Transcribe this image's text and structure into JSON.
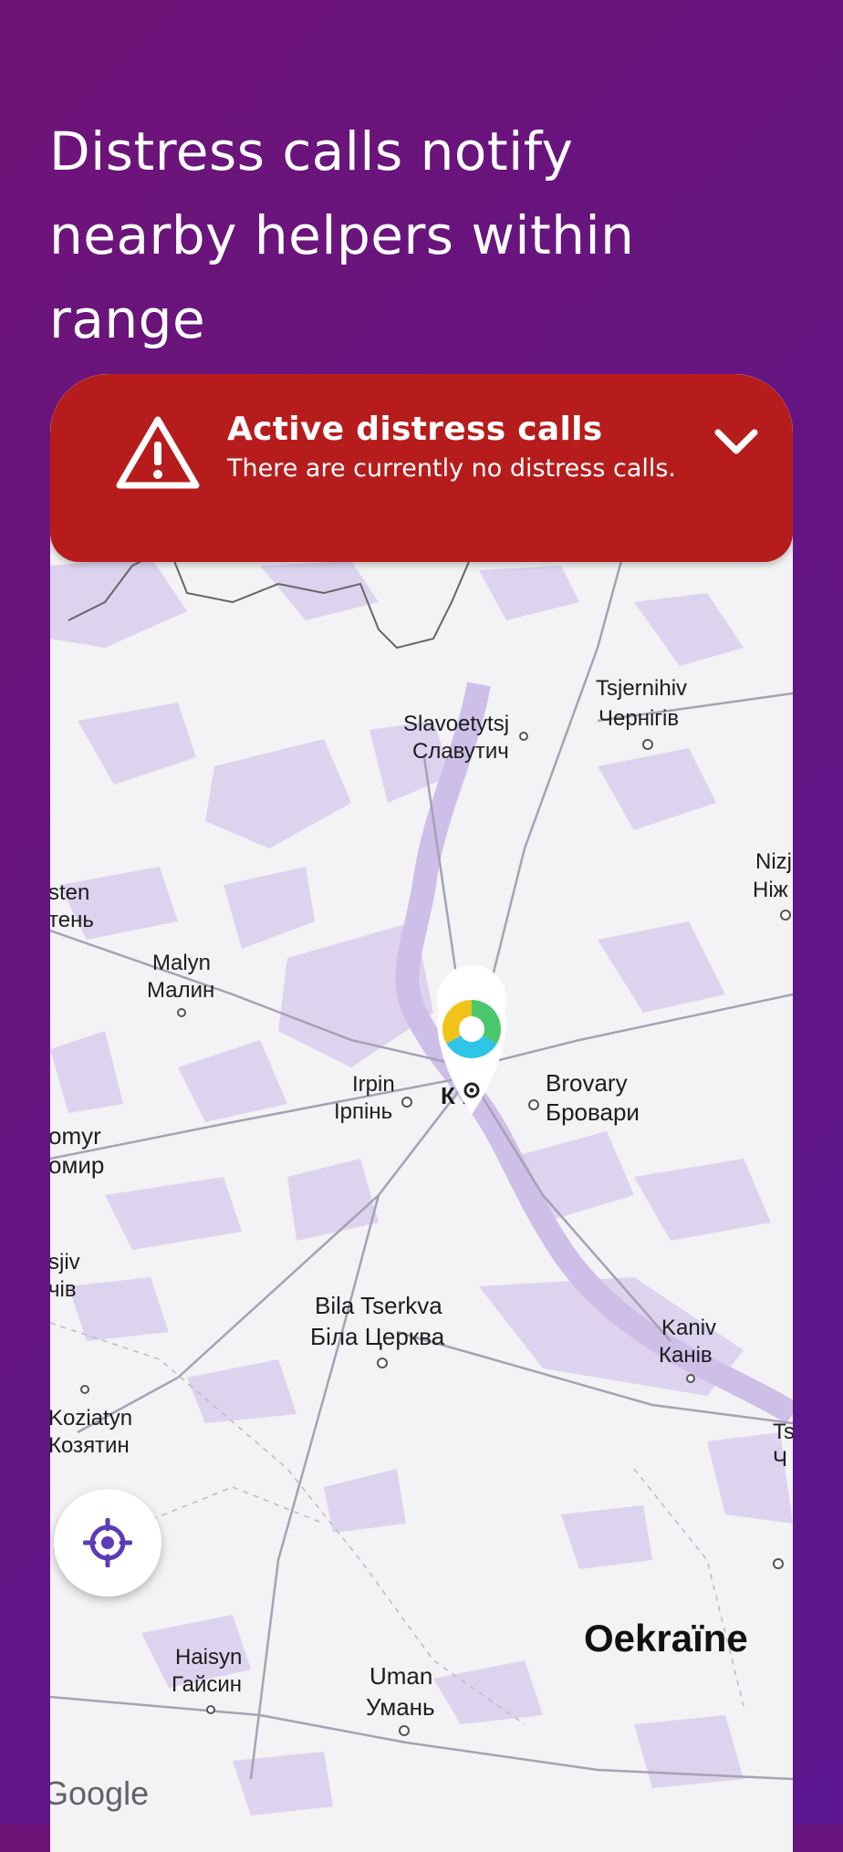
{
  "headline": [
    "Distress calls notify",
    "nearby helpers within",
    "range"
  ],
  "banner": {
    "title": "Active distress calls",
    "subtitle": "There are currently no distress calls.",
    "icon": "warning-triangle-icon",
    "toggle_icon": "chevron-down-icon",
    "color": "#b71c1c"
  },
  "map": {
    "cities": [
      {
        "id": "chernihiv",
        "name": "Tsjernihiv",
        "local": "Чернігів"
      },
      {
        "id": "slavutych",
        "name": "Slavoetytsj",
        "local": "Славутич"
      },
      {
        "id": "nizhyn",
        "name": "Nizj",
        "local": "Ніж"
      },
      {
        "id": "korosten",
        "name": "sten",
        "local": "тень"
      },
      {
        "id": "malyn",
        "name": "Malyn",
        "local": "Малин"
      },
      {
        "id": "irpin",
        "name": "Irpin",
        "local": "Ірпінь"
      },
      {
        "id": "kyiv",
        "name": "",
        "local": "К  в"
      },
      {
        "id": "brovary",
        "name": "Brovary",
        "local": "Бровари"
      },
      {
        "id": "zhytomyr",
        "name": "omyr",
        "local": "омир"
      },
      {
        "id": "berdychiv",
        "name": "sjiv",
        "local": "чів"
      },
      {
        "id": "bila",
        "name": "Bila Tserkva",
        "local": "Біла Церква"
      },
      {
        "id": "kaniv",
        "name": "Kaniv",
        "local": "Канів"
      },
      {
        "id": "koziatyn",
        "name": "Koziatyn",
        "local": "Козятин"
      },
      {
        "id": "ts",
        "name": "Ts",
        "local": "Ч"
      },
      {
        "id": "haisyn",
        "name": "Haisyn",
        "local": "Гайсин"
      },
      {
        "id": "uman",
        "name": "Uman",
        "local": "Умань"
      }
    ],
    "country": "Oekraïne",
    "attribution": "Google",
    "marker_icon": "location-pin-icon",
    "accent_color": "#5c3ab8"
  },
  "locate_button": {
    "icon": "crosshair-icon"
  }
}
